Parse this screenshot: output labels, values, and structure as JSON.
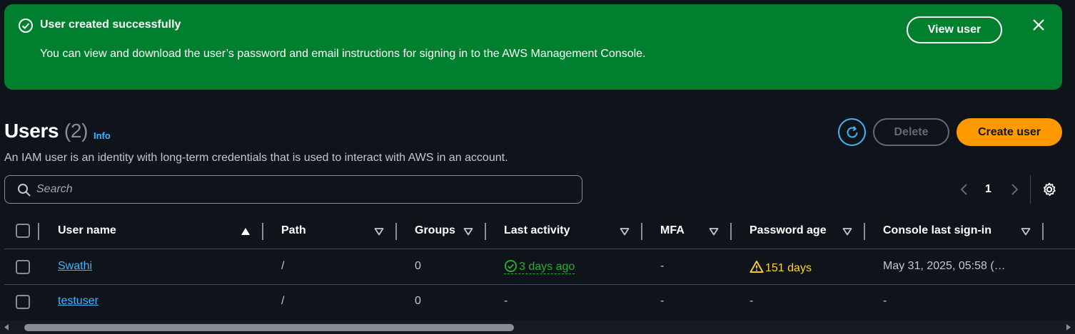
{
  "flash": {
    "title": "User created successfully",
    "message": "You can view and download the user’s password and email instructions for signing in to the AWS Management Console.",
    "action_label": "View user"
  },
  "header": {
    "title": "Users",
    "count": "(2)",
    "info_label": "Info",
    "description": "An IAM user is an identity with long-term credentials that is used to interact with AWS in an account."
  },
  "actions": {
    "delete_label": "Delete",
    "create_label": "Create user"
  },
  "search": {
    "placeholder": "Search",
    "value": ""
  },
  "pagination": {
    "current_page": "1"
  },
  "table": {
    "columns": [
      {
        "label": "User name",
        "sort": "ascending"
      },
      {
        "label": "Path",
        "sort": "none"
      },
      {
        "label": "Groups",
        "sort": "none"
      },
      {
        "label": "Last activity",
        "sort": "none"
      },
      {
        "label": "MFA",
        "sort": "none"
      },
      {
        "label": "Password age",
        "sort": "none"
      },
      {
        "label": "Console last sign-in",
        "sort": "none"
      }
    ],
    "rows": [
      {
        "user_name": "Swathi",
        "path": "/",
        "groups": "0",
        "last_activity": "3 days ago",
        "mfa": "-",
        "password_age": "151 days",
        "console_last_signin": "May 31, 2025, 05:58 (…"
      },
      {
        "user_name": "testuser",
        "path": "/",
        "groups": "0",
        "last_activity": "-",
        "mfa": "-",
        "password_age": "-",
        "console_last_signin": "-"
      }
    ]
  },
  "colors": {
    "success_banner": "#00802f",
    "primary_button": "#ff9900",
    "link": "#42b4ff",
    "activity_ok": "#29ad32",
    "warning": "#fbd332",
    "background": "#0f141a"
  },
  "icons": {
    "flash_status": "check-circle-icon",
    "flash_close": "close-icon",
    "refresh": "refresh-icon",
    "search": "search-icon",
    "prev": "chevron-left-icon",
    "next": "chevron-right-icon",
    "settings": "gear-icon",
    "sort_asc": "caret-up-icon",
    "sort_none": "caret-down-icon",
    "activity": "check-circle-icon",
    "warning": "warning-icon"
  }
}
